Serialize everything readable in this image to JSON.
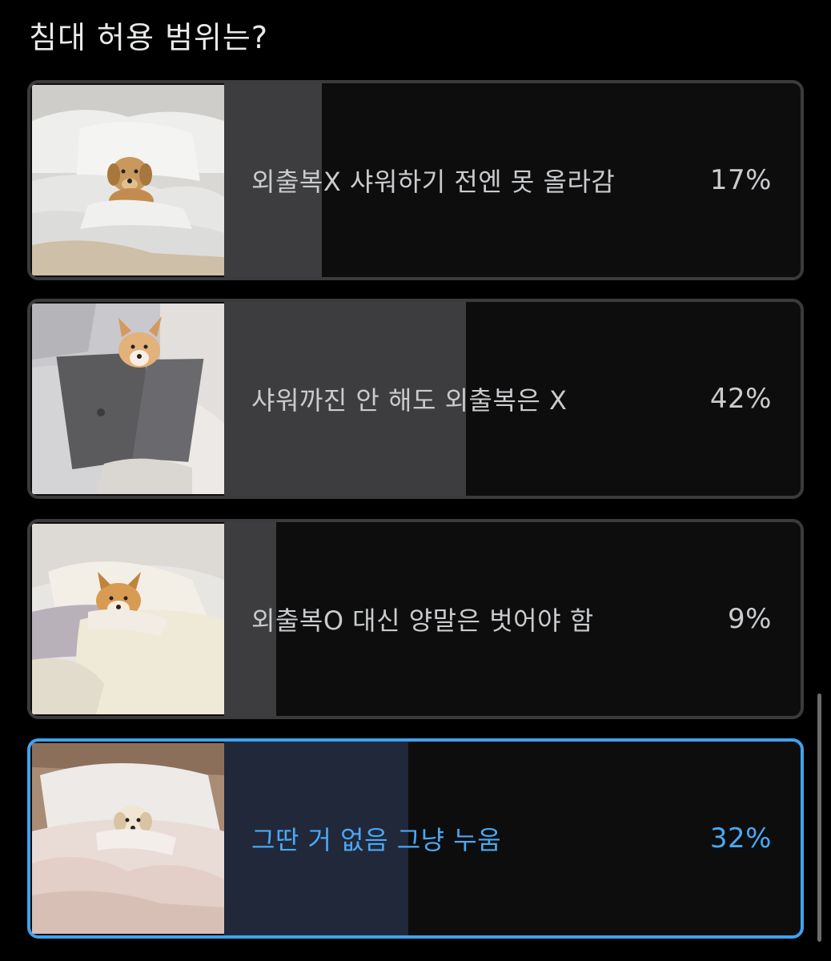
{
  "poll": {
    "question": "침대 허용 범위는?",
    "options": [
      {
        "label": "외출복X 샤워하기 전엔 못 올라감",
        "percent_text": "17%",
        "percent": 17,
        "selected": false,
        "image": "golden-retriever-puppy-in-bed"
      },
      {
        "label": "샤워까진 안 해도 외출복은 X",
        "percent_text": "42%",
        "percent": 42,
        "selected": false,
        "image": "corgi-with-laptop-in-bed"
      },
      {
        "label": "외출복O 대신 양말은 벗어야 함",
        "percent_text": "9%",
        "percent": 9,
        "selected": false,
        "image": "shiba-under-blanket"
      },
      {
        "label": "그딴 거 없음 그냥 누움",
        "percent_text": "32%",
        "percent": 32,
        "selected": true,
        "image": "puppy-between-pillows"
      }
    ]
  },
  "colors": {
    "background": "#000000",
    "option_border": "#3b3b3d",
    "selected_border": "#3ea2f0",
    "bar_fill": "#3d3d3f",
    "selected_bar_fill": "#21283a",
    "selected_text": "#4aa8f2"
  }
}
